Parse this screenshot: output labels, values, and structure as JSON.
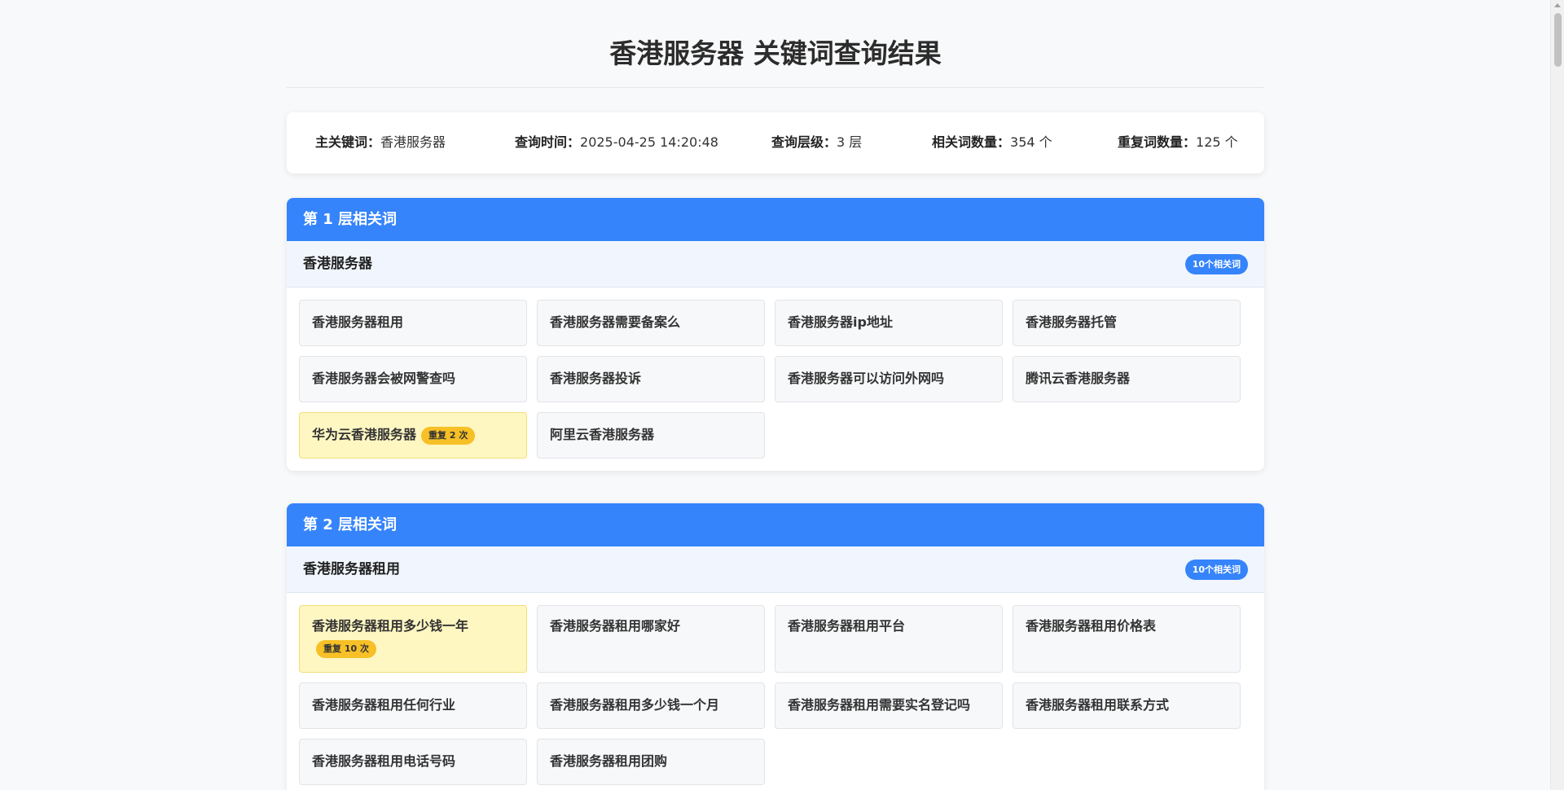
{
  "title": "香港服务器 关键词查询结果",
  "summary": {
    "main_label": "主关键词：",
    "main_value": "香港服务器",
    "time_label": "查询时间：",
    "time_value": "2025-04-25 14:20:48",
    "depth_label": "查询层级：",
    "depth_value": "3 层",
    "related_label": "相关词数量：",
    "related_value": "354 个",
    "dup_label": "重复词数量：",
    "dup_value": "125 个"
  },
  "levels": [
    {
      "title": "第 1 层相关词",
      "group": "香港服务器",
      "count": "10个相关词",
      "keywords": [
        {
          "text": "香港服务器租用"
        },
        {
          "text": "香港服务器需要备案么"
        },
        {
          "text": "香港服务器ip地址"
        },
        {
          "text": "香港服务器托管"
        },
        {
          "text": "香港服务器会被网警查吗"
        },
        {
          "text": "香港服务器投诉"
        },
        {
          "text": "香港服务器可以访问外网吗"
        },
        {
          "text": "腾讯云香港服务器"
        },
        {
          "text": "华为云香港服务器",
          "dup": "重复 2 次"
        },
        {
          "text": "阿里云香港服务器"
        }
      ]
    },
    {
      "title": "第 2 层相关词",
      "group": "香港服务器租用",
      "count": "10个相关词",
      "keywords": [
        {
          "text": "香港服务器租用多少钱一年",
          "dup": "重复 10 次"
        },
        {
          "text": "香港服务器租用哪家好"
        },
        {
          "text": "香港服务器租用平台"
        },
        {
          "text": "香港服务器租用价格表"
        },
        {
          "text": "香港服务器租用任何行业"
        },
        {
          "text": "香港服务器租用多少钱一个月"
        },
        {
          "text": "香港服务器租用需要实名登记吗"
        },
        {
          "text": "香港服务器租用联系方式"
        },
        {
          "text": "香港服务器租用电话号码"
        },
        {
          "text": "香港服务器租用团购"
        }
      ]
    }
  ]
}
